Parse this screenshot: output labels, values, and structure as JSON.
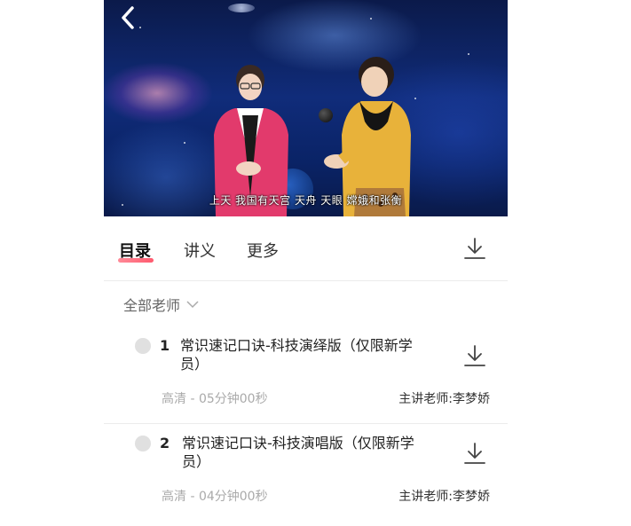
{
  "video": {
    "subtitle": "上天 我国有天宫 天舟 天眼 嫦娥和张衡"
  },
  "tabs": [
    {
      "label": "目录",
      "active": true
    },
    {
      "label": "讲义",
      "active": false
    },
    {
      "label": "更多",
      "active": false
    }
  ],
  "filter": {
    "label": "全部老师"
  },
  "lessons": [
    {
      "number": "1",
      "title": "常识速记口诀-科技演绎版（仅限新学员）",
      "meta": "高清 - 05分钟00秒",
      "teacher": "主讲老师:李梦娇"
    },
    {
      "number": "2",
      "title": "常识速记口诀-科技演唱版（仅限新学员）",
      "meta": "高清 - 04分钟00秒",
      "teacher": "主讲老师:李梦娇"
    }
  ],
  "colors": {
    "accent": "#ff5a6e",
    "text_primary": "#222222",
    "text_secondary": "#aaaaaa"
  }
}
